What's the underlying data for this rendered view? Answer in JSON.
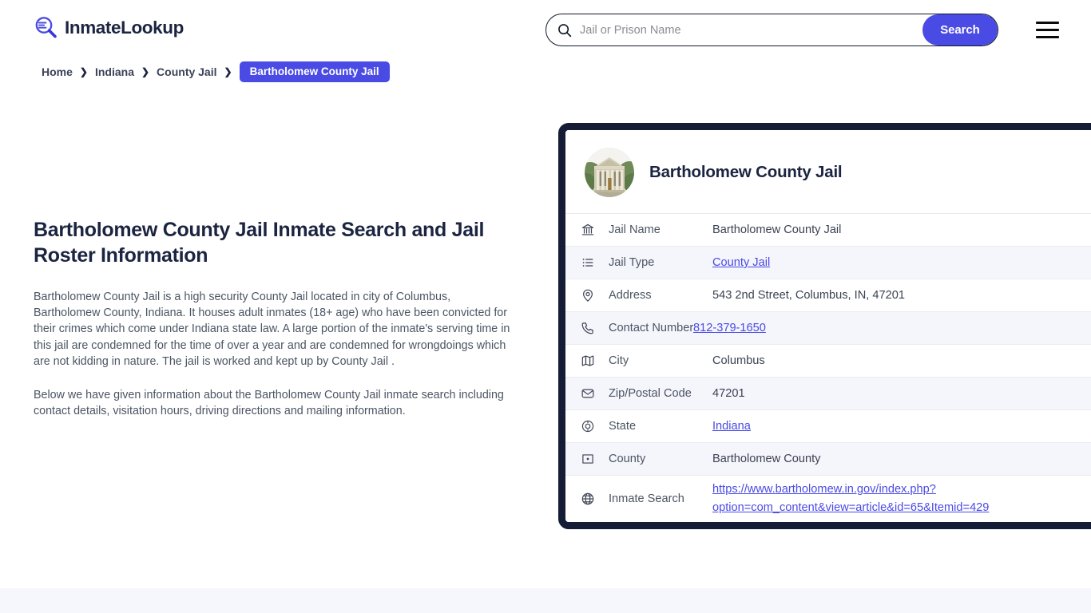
{
  "header": {
    "logo_text": "InmateLookup",
    "logo_icon": "magnifier-list-icon",
    "search": {
      "placeholder": "Jail or Prison Name",
      "value": "",
      "search_icon": "search-icon",
      "button_label": "Search"
    },
    "menu_icon": "hamburger-menu-icon"
  },
  "breadcrumb": {
    "items": [
      {
        "label": "Home"
      },
      {
        "label": "Indiana"
      },
      {
        "label": "County Jail"
      }
    ],
    "separator": "❯",
    "current": "Bartholomew County Jail"
  },
  "main": {
    "title": "Bartholomew County Jail Inmate Search and Jail Roster Information",
    "paragraphs": [
      "Bartholomew County Jail is a high security County Jail located in city of Columbus, Bartholomew County, Indiana. It houses adult inmates (18+ age) who have been convicted for their crimes which come under Indiana state law. A large portion of the inmate's serving time in this jail are condemned for the time of over a year and are condemned for wrongdoings which are not kidding in nature. The jail is worked and kept up by County Jail .",
      "Below we have given information about the Bartholomew County Jail inmate search including contact details, visitation hours, driving directions and mailing information."
    ]
  },
  "card": {
    "avatar_icon": "courthouse-photo",
    "title": "Bartholomew County Jail",
    "rows": [
      {
        "icon": "bank-icon",
        "label": "Jail Name",
        "value": "Bartholomew County Jail",
        "link": false
      },
      {
        "icon": "list-icon",
        "label": "Jail Type",
        "value": "County Jail",
        "link": true
      },
      {
        "icon": "map-pin-icon",
        "label": "Address",
        "value": "543 2nd Street, Columbus, IN, 47201",
        "link": false
      },
      {
        "icon": "phone-icon",
        "label": "Contact Number",
        "value": "812-379-1650",
        "link": true
      },
      {
        "icon": "map-icon",
        "label": "City",
        "value": "Columbus",
        "link": false
      },
      {
        "icon": "envelope-icon",
        "label": "Zip/Postal Code",
        "value": "47201",
        "link": false
      },
      {
        "icon": "globe-pin-icon",
        "label": "State",
        "value": "Indiana",
        "link": true
      },
      {
        "icon": "county-icon",
        "label": "County",
        "value": "Bartholomew County",
        "link": false
      },
      {
        "icon": "globe-icon",
        "label": "Inmate Search",
        "value": "https://www.bartholomew.in.gov/index.php?option=com_content&view=article&id=65&Itemid=429",
        "link": true
      }
    ]
  },
  "colors": {
    "accent": "#4a4ae4",
    "card_border": "#141c36",
    "row_alt": "#f5f5fc",
    "heading": "#1b2440",
    "footer_band": "#f6f6fd"
  }
}
